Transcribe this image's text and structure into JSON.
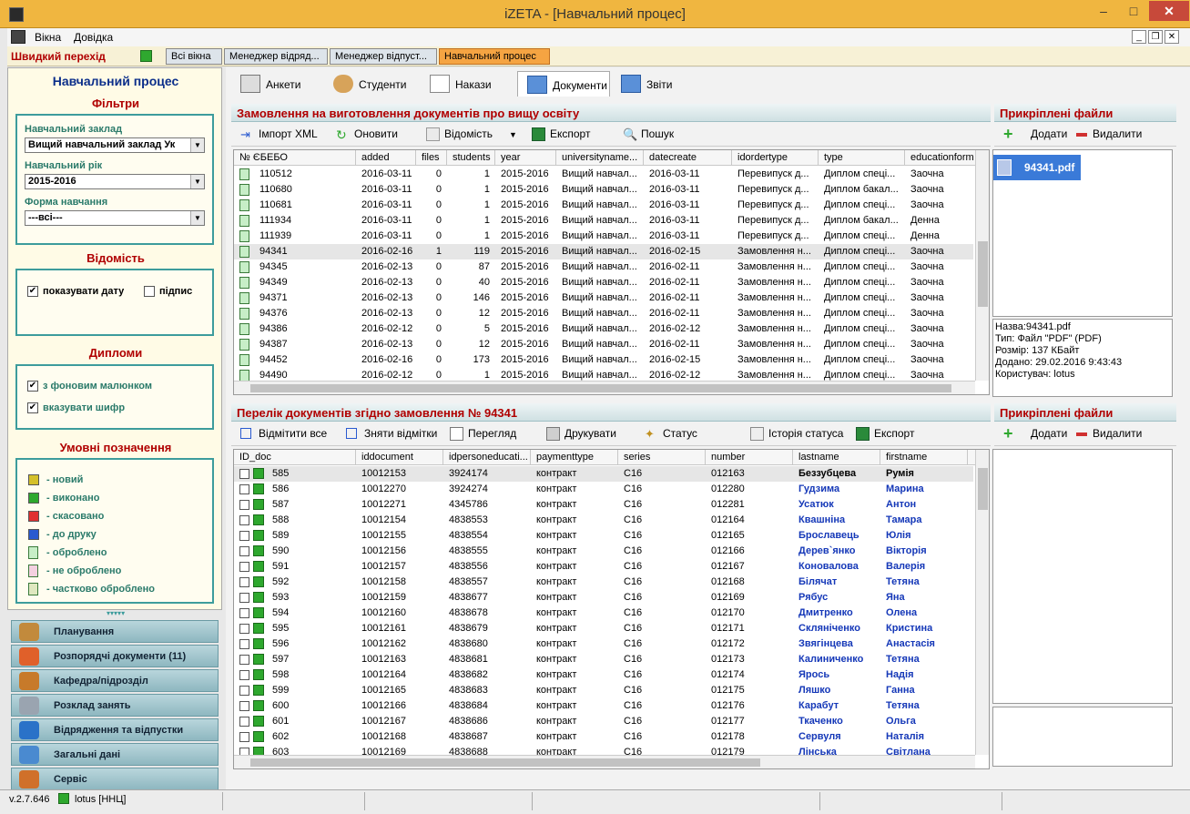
{
  "window": {
    "title": "iZETA - [Навчальний процес]",
    "min": "–",
    "max": "□",
    "close": "✕"
  },
  "menu": {
    "items": [
      "Вікна",
      "Довідка"
    ]
  },
  "quick": {
    "label": "Швидкий перехід",
    "tabs": [
      "Всі вікна",
      "Менеджер відряд...",
      "Менеджер відпуст...",
      "Навчальний процес"
    ],
    "active": 3
  },
  "left": {
    "title": "Навчальний процес",
    "filters": {
      "head": "Фільтри",
      "inst_label": "Навчальний заклад",
      "inst_value": "Вищий навчальний заклад Ук",
      "year_label": "Навчальний рік",
      "year_value": "2015-2016",
      "form_label": "Форма навчання",
      "form_value": "---всі---"
    },
    "vidomist": {
      "head": "Відомість",
      "show_date": "показувати дату",
      "signature": "підпис",
      "show_date_checked": "✔",
      "signature_checked": ""
    },
    "diplomas": {
      "head": "Дипломи",
      "background": "з фоновим малюнком",
      "cipher": "вказувати шифр",
      "background_checked": "✔",
      "cipher_checked": "✔"
    },
    "legend": {
      "head": "Умовні позначення",
      "items": [
        {
          "label": "- новий",
          "color": "#d4c02a",
          "icon": "square"
        },
        {
          "label": "- виконано",
          "color": "#2ea82e",
          "icon": "square"
        },
        {
          "label": "- скасовано",
          "color": "#e03030",
          "icon": "square"
        },
        {
          "label": "- до друку",
          "color": "#2a5ad0",
          "icon": "square"
        },
        {
          "label": "- оброблено",
          "color": "#c7eec7",
          "icon": "doc"
        },
        {
          "label": "- не оброблено",
          "color": "#f3d0e0",
          "icon": "doc"
        },
        {
          "label": "- частково оброблено",
          "color": "#dfe8c0",
          "icon": "doc"
        }
      ]
    },
    "grip": "▾▾▾▾▾"
  },
  "nav": [
    {
      "label": "Планування",
      "color": "#c28a3c"
    },
    {
      "label": "Розпорядчі документи (11)",
      "color": "#e0602a"
    },
    {
      "label": "Кафедра/підрозділ",
      "color": "#c77a2a"
    },
    {
      "label": "Розклад занять",
      "color": "#9aa4b0"
    },
    {
      "label": "Відрядження та відпустки",
      "color": "#2a72c8"
    },
    {
      "label": "Загальні дані",
      "color": "#4a8ad0"
    },
    {
      "label": "Сервіс",
      "color": "#d0702a"
    }
  ],
  "status": {
    "version": "v.2.7.646",
    "user": "lotus [ННЦ]"
  },
  "modtabs": [
    {
      "label": "Анкети"
    },
    {
      "label": "Студенти"
    },
    {
      "label": "Накази"
    },
    {
      "label": "Документи"
    },
    {
      "label": "Звіти"
    }
  ],
  "orders": {
    "head": "Замовлення на виготовлення документів про вищу освіту",
    "toolbar": [
      "Імпорт XML",
      "Оновити",
      "Відомість",
      "Експорт",
      "Пошук"
    ],
    "columns": [
      "№ ЄБЕБО",
      "added",
      "files",
      "students",
      "year",
      "universityname...",
      "datecreate",
      "idordertype",
      "type",
      "educationform"
    ],
    "rows": [
      [
        "110512",
        "2016-03-11",
        "0",
        "1",
        "2015-2016",
        "Вищий навчал...",
        "2016-03-11",
        "Перевипуск д...",
        "Диплом спеці...",
        "Заочна"
      ],
      [
        "110680",
        "2016-03-11",
        "0",
        "1",
        "2015-2016",
        "Вищий навчал...",
        "2016-03-11",
        "Перевипуск д...",
        "Диплом бакал...",
        "Заочна"
      ],
      [
        "110681",
        "2016-03-11",
        "0",
        "1",
        "2015-2016",
        "Вищий навчал...",
        "2016-03-11",
        "Перевипуск д...",
        "Диплом спеці...",
        "Заочна"
      ],
      [
        "111934",
        "2016-03-11",
        "0",
        "1",
        "2015-2016",
        "Вищий навчал...",
        "2016-03-11",
        "Перевипуск д...",
        "Диплом бакал...",
        "Денна"
      ],
      [
        "111939",
        "2016-03-11",
        "0",
        "1",
        "2015-2016",
        "Вищий навчал...",
        "2016-03-11",
        "Перевипуск д...",
        "Диплом спеці...",
        "Денна"
      ],
      [
        "94341",
        "2016-02-16",
        "1",
        "119",
        "2015-2016",
        "Вищий навчал...",
        "2016-02-15",
        "Замовлення н...",
        "Диплом спеці...",
        "Заочна"
      ],
      [
        "94345",
        "2016-02-13",
        "0",
        "87",
        "2015-2016",
        "Вищий навчал...",
        "2016-02-11",
        "Замовлення н...",
        "Диплом спеці...",
        "Заочна"
      ],
      [
        "94349",
        "2016-02-13",
        "0",
        "40",
        "2015-2016",
        "Вищий навчал...",
        "2016-02-11",
        "Замовлення н...",
        "Диплом спеці...",
        "Заочна"
      ],
      [
        "94371",
        "2016-02-13",
        "0",
        "146",
        "2015-2016",
        "Вищий навчал...",
        "2016-02-11",
        "Замовлення н...",
        "Диплом спеці...",
        "Заочна"
      ],
      [
        "94376",
        "2016-02-13",
        "0",
        "12",
        "2015-2016",
        "Вищий навчал...",
        "2016-02-11",
        "Замовлення н...",
        "Диплом спеці...",
        "Заочна"
      ],
      [
        "94386",
        "2016-02-12",
        "0",
        "5",
        "2015-2016",
        "Вищий навчал...",
        "2016-02-12",
        "Замовлення н...",
        "Диплом спеці...",
        "Заочна"
      ],
      [
        "94387",
        "2016-02-13",
        "0",
        "12",
        "2015-2016",
        "Вищий навчал...",
        "2016-02-11",
        "Замовлення н...",
        "Диплом спеці...",
        "Заочна"
      ],
      [
        "94452",
        "2016-02-16",
        "0",
        "173",
        "2015-2016",
        "Вищий навчал...",
        "2016-02-15",
        "Замовлення н...",
        "Диплом спеці...",
        "Заочна"
      ],
      [
        "94490",
        "2016-02-12",
        "0",
        "1",
        "2015-2016",
        "Вищий навчал...",
        "2016-02-12",
        "Замовлення н...",
        "Диплом спеці...",
        "Заочна"
      ]
    ],
    "selected_index": 5
  },
  "attached1": {
    "head": "Прикріплені файли",
    "add": "Додати",
    "del": "Видалити",
    "file": "94341.pdf",
    "info": [
      "Назва:94341.pdf",
      "Тип: Файл \"PDF\" (PDF)",
      "Розмір: 137 КБайт",
      "Додано: 29.02.2016 9:43:43",
      "Користувач: lotus"
    ]
  },
  "docs": {
    "head": "Перелік документів згідно замовлення № 94341",
    "toolbar": [
      "Відмітити все",
      "Зняти відмітки",
      "Перегляд",
      "Друкувати",
      "Статус",
      "Історія статуса",
      "Експорт"
    ],
    "columns": [
      "ID_doc",
      "iddocument",
      "idpersoneducati...",
      "paymenttype",
      "series",
      "number",
      "lastname",
      "firstname"
    ],
    "rows": [
      [
        "585",
        "10012153",
        "3924174",
        "контракт",
        "C16",
        "012163",
        "Беззубцева",
        "Румія"
      ],
      [
        "586",
        "10012270",
        "3924274",
        "контракт",
        "C16",
        "012280",
        "Гудзима",
        "Марина"
      ],
      [
        "587",
        "10012271",
        "4345786",
        "контракт",
        "C16",
        "012281",
        "Усатюк",
        "Антон"
      ],
      [
        "588",
        "10012154",
        "4838553",
        "контракт",
        "C16",
        "012164",
        "Квашніна",
        "Тамара"
      ],
      [
        "589",
        "10012155",
        "4838554",
        "контракт",
        "C16",
        "012165",
        "Брославець",
        "Юлія"
      ],
      [
        "590",
        "10012156",
        "4838555",
        "контракт",
        "C16",
        "012166",
        "Дерев`янко",
        "Вікторія"
      ],
      [
        "591",
        "10012157",
        "4838556",
        "контракт",
        "C16",
        "012167",
        "Коновалова",
        "Валерія"
      ],
      [
        "592",
        "10012158",
        "4838557",
        "контракт",
        "C16",
        "012168",
        "Білячат",
        "Тетяна"
      ],
      [
        "593",
        "10012159",
        "4838677",
        "контракт",
        "C16",
        "012169",
        "Рябус",
        "Яна"
      ],
      [
        "594",
        "10012160",
        "4838678",
        "контракт",
        "C16",
        "012170",
        "Дмитренко",
        "Олена"
      ],
      [
        "595",
        "10012161",
        "4838679",
        "контракт",
        "C16",
        "012171",
        "Скляніченко",
        "Кристина"
      ],
      [
        "596",
        "10012162",
        "4838680",
        "контракт",
        "C16",
        "012172",
        "Звягінцева",
        "Анастасія"
      ],
      [
        "597",
        "10012163",
        "4838681",
        "контракт",
        "C16",
        "012173",
        "Калиниченко",
        "Тетяна"
      ],
      [
        "598",
        "10012164",
        "4838682",
        "контракт",
        "C16",
        "012174",
        "Ярось",
        "Надія"
      ],
      [
        "599",
        "10012165",
        "4838683",
        "контракт",
        "C16",
        "012175",
        "Ляшко",
        "Ганна"
      ],
      [
        "600",
        "10012166",
        "4838684",
        "контракт",
        "C16",
        "012176",
        "Карабут",
        "Тетяна"
      ],
      [
        "601",
        "10012167",
        "4838686",
        "контракт",
        "C16",
        "012177",
        "Ткаченко",
        "Ольга"
      ],
      [
        "602",
        "10012168",
        "4838687",
        "контракт",
        "C16",
        "012178",
        "Сервуля",
        "Наталія"
      ],
      [
        "603",
        "10012169",
        "4838688",
        "контракт",
        "C16",
        "012179",
        "Лінська",
        "Світлана"
      ]
    ],
    "selected_index": 0
  },
  "attached2": {
    "head": "Прикріплені файли",
    "add": "Додати",
    "del": "Видалити"
  }
}
